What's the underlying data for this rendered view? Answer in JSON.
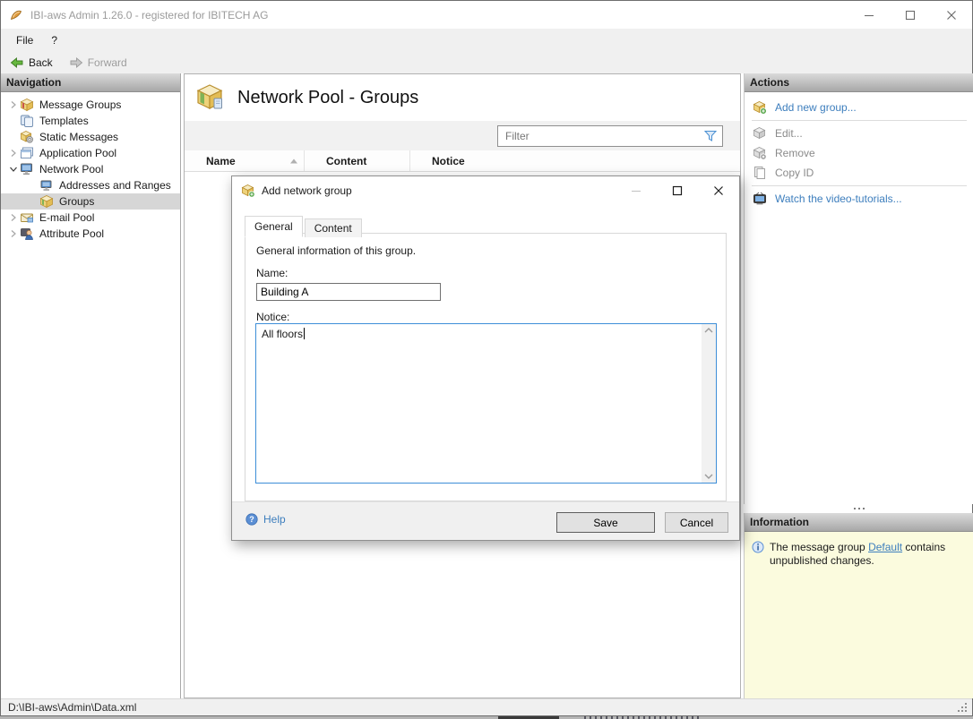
{
  "titlebar": {
    "title": "IBI-aws Admin 1.26.0 - registered for IBITECH AG"
  },
  "menubar": {
    "file": "File",
    "help": "?"
  },
  "toolbar": {
    "back": "Back",
    "forward": "Forward"
  },
  "navigation": {
    "header": "Navigation",
    "items": [
      {
        "label": "Message Groups"
      },
      {
        "label": "Templates"
      },
      {
        "label": "Static Messages"
      },
      {
        "label": "Application Pool"
      },
      {
        "label": "Network Pool"
      },
      {
        "label": "Addresses and Ranges"
      },
      {
        "label": "Groups"
      },
      {
        "label": "E-mail Pool"
      },
      {
        "label": "Attribute Pool"
      }
    ]
  },
  "main": {
    "title": "Network Pool - Groups",
    "filter": {
      "placeholder": "Filter"
    },
    "table": {
      "columns": [
        "Name",
        "Content",
        "Notice"
      ]
    }
  },
  "dialog": {
    "title": "Add network group",
    "tabs": [
      {
        "label": "General"
      },
      {
        "label": "Content"
      }
    ],
    "description": "General information of this group.",
    "name": {
      "label": "Name:",
      "value": "Building A"
    },
    "notice": {
      "label": "Notice:",
      "value": "All floors"
    },
    "help": "Help",
    "buttons": {
      "save": "Save",
      "cancel": "Cancel"
    }
  },
  "actions": {
    "header": "Actions",
    "items": [
      {
        "label": "Add new group..."
      },
      {
        "label": "Edit..."
      },
      {
        "label": "Remove"
      },
      {
        "label": "Copy ID"
      },
      {
        "label": "Watch the video-tutorials..."
      }
    ]
  },
  "information": {
    "header": "Information",
    "message_prefix": "The message group ",
    "link": "Default",
    "message_suffix": " contains unpublished changes."
  },
  "statusbar": {
    "path": "D:\\IBI-aws\\Admin\\Data.xml"
  },
  "colors": {
    "link_blue": "#3d7ebd",
    "focus_blue": "#3d8ed8",
    "info_bg": "#fbfbde",
    "selection_gray": "#d6d6d6"
  }
}
